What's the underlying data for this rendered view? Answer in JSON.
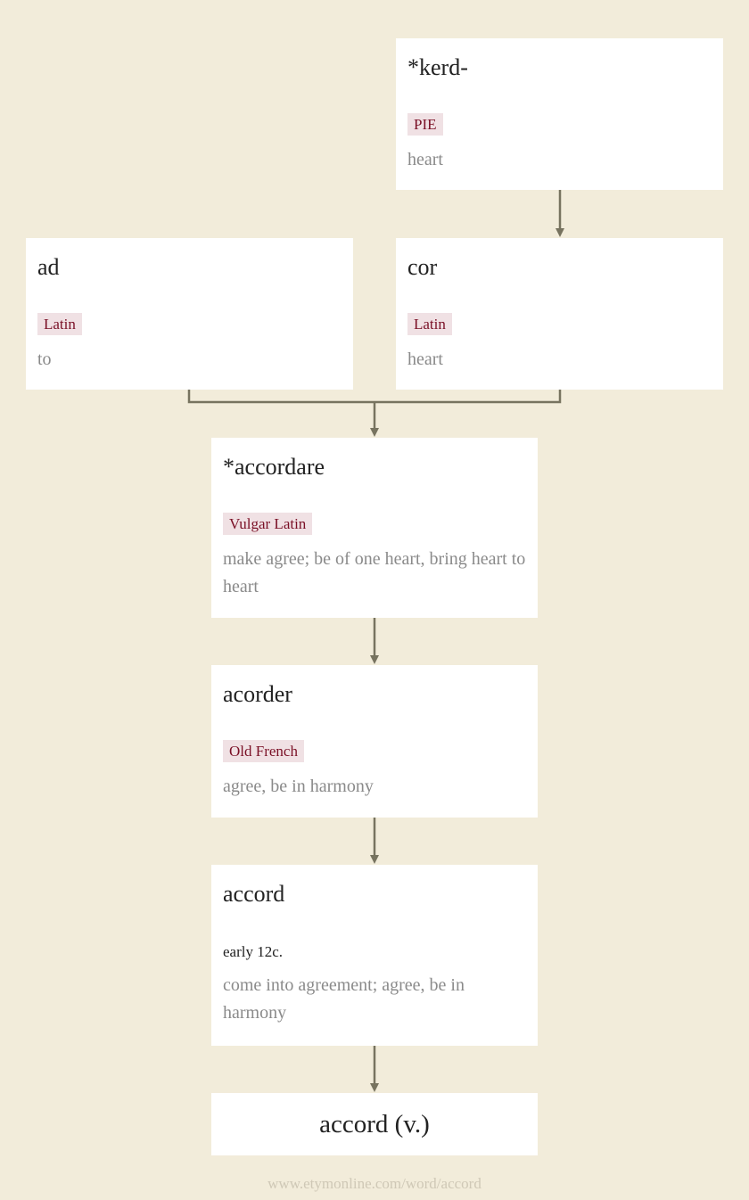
{
  "nodes": {
    "kerd": {
      "word": "*kerd-",
      "language": "PIE",
      "gloss": "heart"
    },
    "ad": {
      "word": "ad",
      "language": "Latin",
      "gloss": "to"
    },
    "cor": {
      "word": "cor",
      "language": "Latin",
      "gloss": "heart"
    },
    "accordare": {
      "word": "*accordare",
      "language": "Vulgar Latin",
      "gloss": "make agree; be of one heart, bring heart to heart"
    },
    "acorder": {
      "word": "acorder",
      "language": "Old French",
      "gloss": "agree, be in harmony"
    },
    "accord": {
      "word": "accord",
      "date": "early 12c.",
      "gloss": "come into agreement; agree, be in harmony"
    },
    "final": {
      "word": "accord (v.)"
    }
  },
  "colors": {
    "background": "#f2ecda",
    "card": "#ffffff",
    "tag_bg": "#f0e1e4",
    "tag_text": "#7a1026",
    "connector": "#77735f",
    "gloss": "#8a8a8a"
  },
  "footer": {
    "url": "www.etymonline.com/word/accord"
  }
}
